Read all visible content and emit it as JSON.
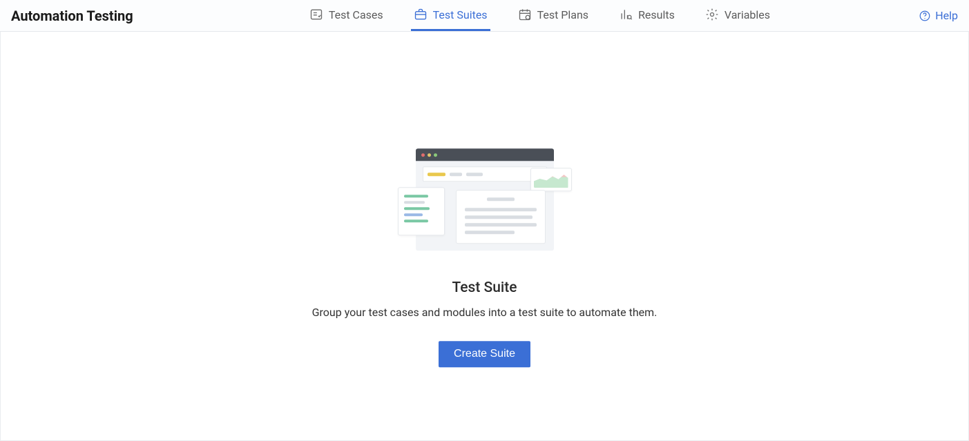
{
  "header": {
    "title": "Automation Testing",
    "help_label": "Help"
  },
  "nav": {
    "items": [
      {
        "label": "Test Cases",
        "icon": "list-check-icon",
        "active": false
      },
      {
        "label": "Test Suites",
        "icon": "briefcase-icon",
        "active": true
      },
      {
        "label": "Test Plans",
        "icon": "calendar-icon",
        "active": false
      },
      {
        "label": "Results",
        "icon": "bar-chart-icon",
        "active": false
      },
      {
        "label": "Variables",
        "icon": "gear-icon",
        "active": false
      }
    ]
  },
  "empty_state": {
    "title": "Test Suite",
    "description": "Group your test cases and modules into a test suite to automate them.",
    "cta_label": "Create Suite"
  },
  "colors": {
    "accent": "#3b6fd6",
    "border": "#e5e8ec"
  }
}
